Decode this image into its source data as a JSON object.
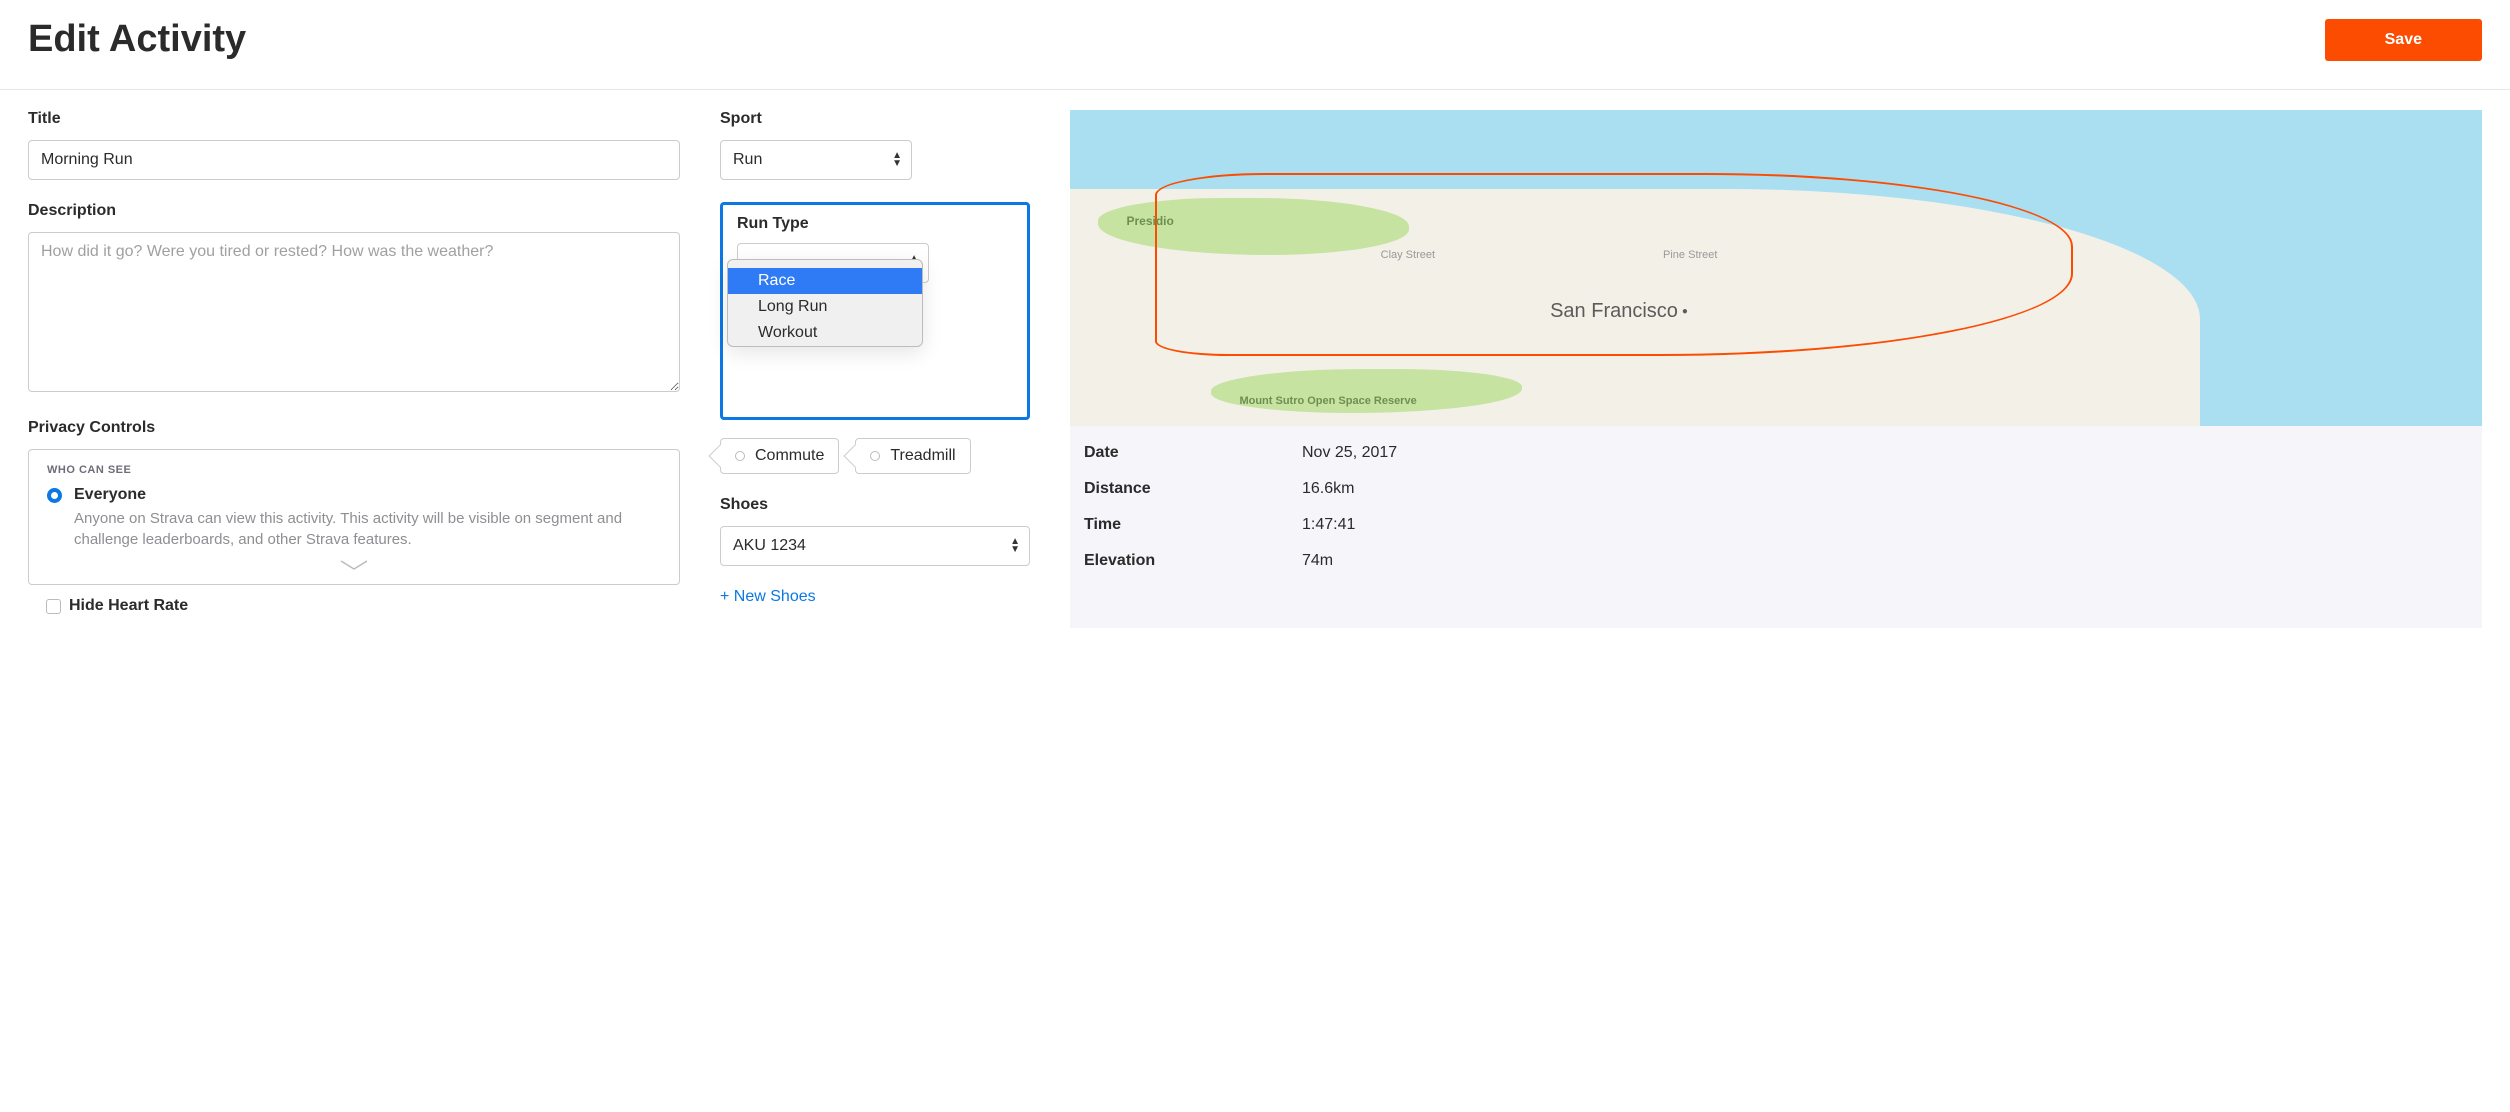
{
  "header": {
    "title": "Edit Activity",
    "save_label": "Save"
  },
  "title_field": {
    "label": "Title",
    "value": "Morning Run"
  },
  "description_field": {
    "label": "Description",
    "placeholder": "How did it go? Were you tired or rested? How was the weather?"
  },
  "privacy": {
    "label": "Privacy Controls",
    "who_can_see": "WHO CAN SEE",
    "option_title": "Everyone",
    "option_desc": "Anyone on Strava can view this activity. This activity will be visible on segment and challenge leaderboards, and other Strava features."
  },
  "hide_hr_label": "Hide Heart Rate",
  "sport": {
    "label": "Sport",
    "value": "Run"
  },
  "run_type": {
    "label": "Run Type",
    "options": {
      "blank": "",
      "race": "Race",
      "long_run": "Long Run",
      "workout": "Workout"
    }
  },
  "tags": {
    "commute": "Commute",
    "treadmill": "Treadmill"
  },
  "shoes": {
    "label": "Shoes",
    "value": "AKU 1234",
    "new_shoes": "+ New Shoes"
  },
  "map": {
    "city": "San Francisco",
    "presidio": "Presidio",
    "clay": "Clay Street",
    "pine": "Pine Street",
    "sutro": "Mount Sutro Open Space Reserve"
  },
  "stats": {
    "date_label": "Date",
    "date_value": "Nov 25, 2017",
    "distance_label": "Distance",
    "distance_value": "16.6km",
    "time_label": "Time",
    "time_value": "1:47:41",
    "elevation_label": "Elevation",
    "elevation_value": "74m"
  }
}
